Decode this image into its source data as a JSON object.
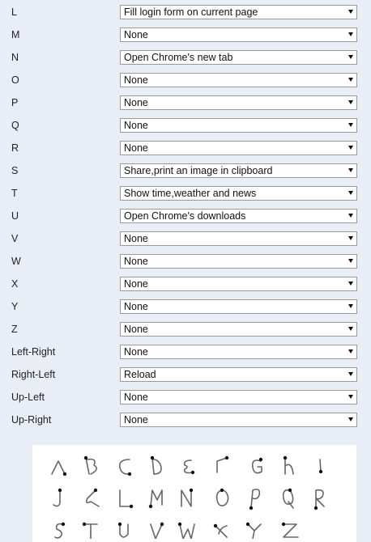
{
  "settings": {
    "rows": [
      {
        "label": "L",
        "value": "Fill login form on current page"
      },
      {
        "label": "M",
        "value": "None"
      },
      {
        "label": "N",
        "value": "Open Chrome's new tab"
      },
      {
        "label": "O",
        "value": "None"
      },
      {
        "label": "P",
        "value": "None"
      },
      {
        "label": "Q",
        "value": "None"
      },
      {
        "label": "R",
        "value": "None"
      },
      {
        "label": "S",
        "value": "Share,print an image in clipboard"
      },
      {
        "label": "T",
        "value": "Show time,weather and news"
      },
      {
        "label": "U",
        "value": "Open Chrome's downloads"
      },
      {
        "label": "V",
        "value": "None"
      },
      {
        "label": "W",
        "value": "None"
      },
      {
        "label": "X",
        "value": "None"
      },
      {
        "label": "Y",
        "value": "None"
      },
      {
        "label": "Z",
        "value": "None"
      },
      {
        "label": "Left-Right",
        "value": "None"
      },
      {
        "label": "Right-Left",
        "value": "Reload"
      },
      {
        "label": "Up-Left",
        "value": "None"
      },
      {
        "label": "Up-Right",
        "value": "None"
      }
    ]
  },
  "gesture_guide": {
    "glyphs": [
      "A",
      "B",
      "C",
      "D",
      "E",
      "F",
      "G",
      "h",
      "i",
      "J",
      "K",
      "L",
      "M",
      "N",
      "O",
      "P",
      "Q",
      "R",
      "S",
      "T",
      "U",
      "V",
      "W",
      "X",
      "Y",
      "Z"
    ]
  }
}
